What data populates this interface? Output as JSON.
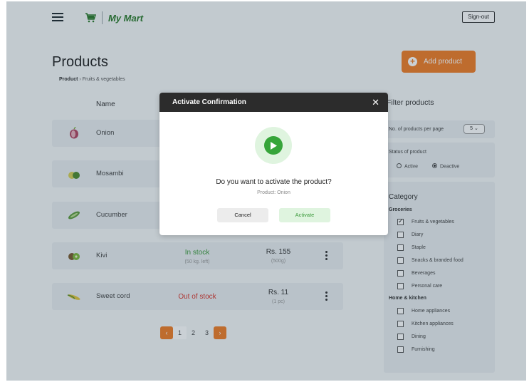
{
  "header": {
    "brand": "My Mart",
    "signout_label": "Sign-out"
  },
  "page": {
    "title": "Products",
    "breadcrumb_root": "Product",
    "breadcrumb_sep": "›",
    "breadcrumb_leaf": "Fruits & vegetables",
    "add_label": "Add product"
  },
  "table": {
    "name_header": "Name",
    "rows": [
      {
        "name": "Onion"
      },
      {
        "name": "Mosambi"
      },
      {
        "name": "Cucumber"
      },
      {
        "name": "Kivi",
        "stock": "In stock",
        "stock_sub": "(50 kg. left)",
        "price": "Rs. 155",
        "unit": "(500g)"
      },
      {
        "name": "Sweet cord",
        "stock": "Out of stock",
        "price": "Rs. 11",
        "unit": "(1 pc)"
      }
    ]
  },
  "pagination": {
    "prev": "‹",
    "pages": [
      "1",
      "2",
      "3"
    ],
    "next": "›"
  },
  "filters": {
    "title": "Filter products",
    "per_page_label": "No. of products per page",
    "per_page_value": "5",
    "status_label": "Status of product",
    "status_active": "Active",
    "status_deactive": "Deactive",
    "category_title": "Category",
    "groceries_label": "Groceries",
    "groceries": [
      "Fruits & vegetables",
      "Diary",
      "Staple",
      "Snacks & branded food",
      "Beverages",
      "Personal care"
    ],
    "home_label": "Home & kitchen",
    "home": [
      "Home appliances",
      "Kitchen appliances",
      "Dining",
      "Furnishing"
    ]
  },
  "modal": {
    "title": "Activate Confirmation",
    "close": "✕",
    "question": "Do you want to activate the product?",
    "product_line": "Product: Onion",
    "cancel_label": "Cancel",
    "activate_label": "Activate"
  },
  "colors": {
    "accent": "#f07c24",
    "in_stock": "#3c9a3c",
    "out_of_stock": "#d9352b",
    "modal_header": "#2c2c2c"
  }
}
